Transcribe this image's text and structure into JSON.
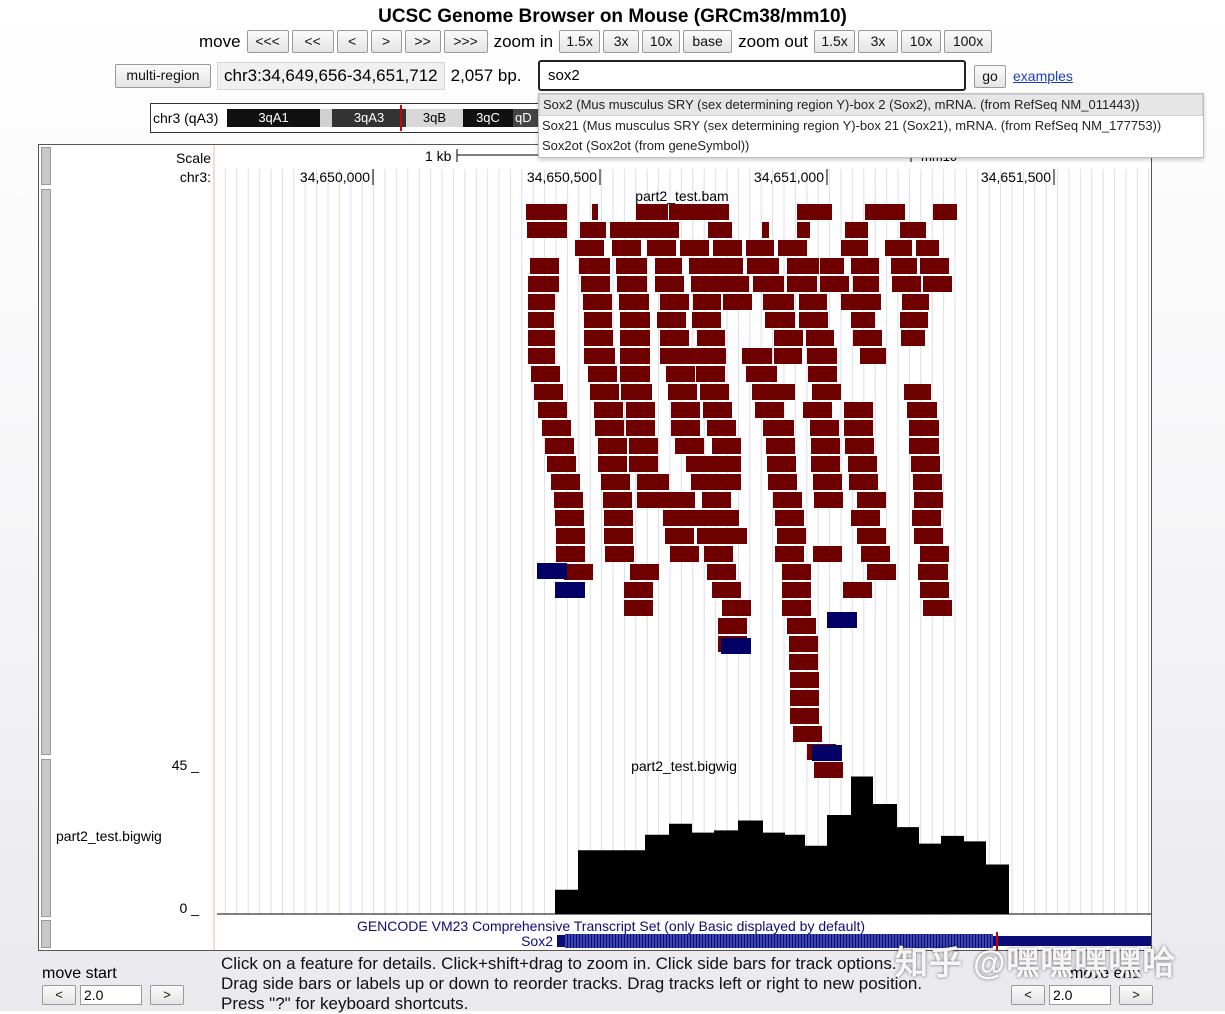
{
  "title": "UCSC Genome Browser on Mouse (GRCm38/mm10)",
  "nav": {
    "move_label": "move",
    "move_buttons": [
      "<<<",
      "<<",
      "<",
      ">",
      ">>",
      ">>>"
    ],
    "zoom_in_label": "zoom in",
    "zoom_in_buttons": [
      "1.5x",
      "3x",
      "10x",
      "base"
    ],
    "zoom_out_label": "zoom out",
    "zoom_out_buttons": [
      "1.5x",
      "3x",
      "10x",
      "100x"
    ]
  },
  "position": {
    "multi_region_label": "multi-region",
    "coordinates": "chr3:34,649,656-34,651,712",
    "size": "2,057 bp.",
    "search_value": "sox2",
    "go_label": "go",
    "examples_label": "examples"
  },
  "autocomplete": [
    "Sox2 (Mus musculus SRY (sex determining region Y)-box 2 (Sox2), mRNA. (from RefSeq NM_011443))",
    "Sox21 (Mus musculus SRY (sex determining region Y)-box 21 (Sox21), mRNA. (from RefSeq NM_177753))",
    "Sox2ot (Sox2ot (from geneSymbol))"
  ],
  "ideogram": {
    "chrom_label": "chr3 (qA3)",
    "bands": [
      "3qA1",
      "3qA3",
      "3qB",
      "3qC",
      "qD"
    ]
  },
  "tracks": {
    "scale_label": "Scale",
    "scale_value": "1 kb",
    "mm_label": "mm10",
    "chr_label": "chr3:",
    "ticks": [
      "34,650,000",
      "34,650,500",
      "34,651,000",
      "34,651,500"
    ],
    "bam_name": "part2_test.bam",
    "bigwig_name": "part2_test.bigwig",
    "bigwig_side_label": "part2_test.bigwig",
    "bigwig_max": "45 _",
    "bigwig_min": "0 _",
    "gencode_label": "GENCODE VM23 Comprehensive Transcript Set (only Basic displayed by default)",
    "gene_label": "Sox2"
  },
  "footer": {
    "line1": "Click on a feature for details. Click+shift+drag to zoom in. Click side bars for track options.",
    "line2": "Drag side bars or labels up or down to reorder tracks. Drag tracks left or right to new position.",
    "line3": "Press \"?\" for keyboard shortcuts.",
    "move_start_label": "move start",
    "move_end_label": "move end",
    "move_start_value": "2.0",
    "move_end_value": "2.0",
    "left_arrow": "<",
    "right_arrow": ">"
  },
  "watermark": "知乎 @嘿嘿嘿嘿哈",
  "colors": {
    "read_forward": "#6e0000",
    "read_reverse": "#000066",
    "coverage": "#000000",
    "gene": "#0c0c78"
  }
}
